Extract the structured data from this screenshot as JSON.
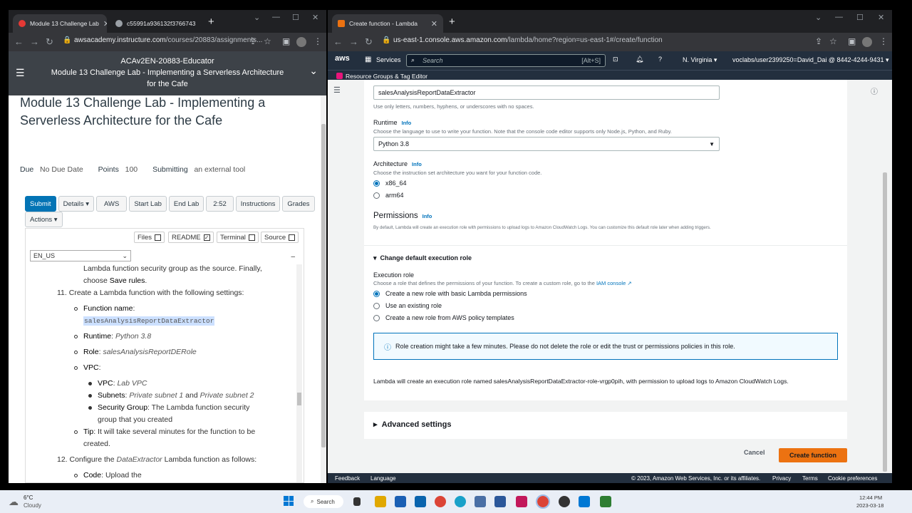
{
  "left_browser": {
    "tabs": [
      {
        "title": "Module 13 Challenge Lab",
        "active": true
      },
      {
        "title": "c55991a936132f3766743",
        "active": false
      }
    ],
    "url_host": "awsacademy.instructure.com",
    "url_path": "/courses/20883/assignments...",
    "course_header": {
      "line1": "ACAv2EN-20883-Educator",
      "line2": "Module 13 Challenge Lab - Implementing a Serverless Architecture",
      "line3": "for the Cafe"
    },
    "page_title": "Module 13 Challenge Lab - Implementing a Serverless Architecture for the Cafe",
    "meta": {
      "due_label": "Due",
      "due_value": "No Due Date",
      "points_label": "Points",
      "points_value": "100",
      "submitting_label": "Submitting",
      "submitting_value": "an external tool"
    },
    "buttons": [
      "Submit",
      "Details ▾",
      "AWS",
      "Start Lab",
      "End Lab",
      "2:52",
      "Instructions",
      "Grades"
    ],
    "actions_label": "Actions ▾",
    "toggles": [
      {
        "label": "Files",
        "checked": false
      },
      {
        "label": "README",
        "checked": true
      },
      {
        "label": "Terminal",
        "checked": false
      },
      {
        "label": "Source",
        "checked": false
      }
    ],
    "language_select": "EN_US",
    "instructions": {
      "l1": "Lambda function security group as the source. Finally,",
      "l2_a": "choose ",
      "l2_b": "Save rules",
      "step11": "11. Create a Lambda function with the following settings:",
      "fn_label": "Function name",
      "fn_value": "salesAnalysisReportDataExtractor",
      "runtime_label": "Runtime",
      "runtime_value": "Python 3.8",
      "role_label": "Role",
      "role_value": "salesAnalysisReportDERole",
      "vpc_label": "VPC",
      "vpc_sub_label": "VPC",
      "vpc_sub_value": "Lab VPC",
      "subnets_label": "Subnets",
      "subnets_value_a": "Private subnet 1",
      "subnets_and": " and ",
      "subnets_value_b": "Private subnet 2",
      "sg_label": "Security Group",
      "sg_value_a": ": The Lambda function security",
      "sg_value_b": "group that you created",
      "tip_label": "Tip",
      "tip_a": ": It will take several minutes for the function to be",
      "tip_b": "created.",
      "step12_a": "12. Configure the ",
      "step12_b": "DataExtractor",
      "step12_c": " Lambda function as follows:",
      "code_label": "Code",
      "code_value": ": Upload the"
    }
  },
  "right_browser": {
    "tab_title": "Create function - Lambda",
    "url_host": "us-east-1.console.aws.amazon.com",
    "url_path": "/lambda/home?region=us-east-1#/create/function",
    "nav": {
      "services": "Services",
      "search_placeholder": "Search",
      "shortcut": "[Alt+S]",
      "region": "N. Virginia ▾",
      "account": "voclabs/user2399250=David_Dai @ 8442-4244-9431 ▾",
      "resource_groups": "Resource Groups & Tag Editor"
    },
    "form": {
      "function_name_value": "salesAnalysisReportDataExtractor",
      "function_name_hint": "Use only letters, numbers, hyphens, or underscores with no spaces.",
      "runtime_label": "Runtime",
      "runtime_hint": "Choose the language to use to write your function. Note that the console code editor supports only Node.js, Python, and Ruby.",
      "runtime_value": "Python 3.8",
      "arch_label": "Architecture",
      "arch_hint": "Choose the instruction set architecture you want for your function code.",
      "arch_options": [
        "x86_64",
        "arm64"
      ],
      "info": "Info",
      "permissions_title": "Permissions",
      "permissions_hint": "By default, Lambda will create an execution role with permissions to upload logs to Amazon CloudWatch Logs. You can customize this default role later when adding triggers.",
      "change_role": "Change default execution role",
      "exec_role_label": "Execution role",
      "exec_role_hint": "Choose a role that defines the permissions of your function. To create a custom role, go to the",
      "iam_link": "IAM console",
      "role_options": [
        "Create a new role with basic Lambda permissions",
        "Use an existing role",
        "Create a new role from AWS policy templates"
      ],
      "alert": "Role creation might take a few minutes. Please do not delete the role or edit the trust or permissions policies in this role.",
      "role_note": "Lambda will create an execution role named salesAnalysisReportDataExtractor-role-vrgp0pih, with permission to upload logs to Amazon CloudWatch Logs.",
      "advanced": "Advanced settings",
      "cancel": "Cancel",
      "create": "Create function"
    },
    "footer": {
      "feedback": "Feedback",
      "language": "Language",
      "copyright": "© 2023, Amazon Web Services, Inc. or its affiliates.",
      "privacy": "Privacy",
      "terms": "Terms",
      "cookie": "Cookie preferences"
    }
  },
  "taskbar": {
    "weather_temp": "6°C",
    "weather_desc": "Cloudy",
    "search": "Search",
    "time": "12:44 PM",
    "date": "2023-03-18"
  },
  "colors": {
    "aws_orange": "#ec7211",
    "aws_nav": "#232f3e",
    "canvas_blue": "#0374b5"
  }
}
